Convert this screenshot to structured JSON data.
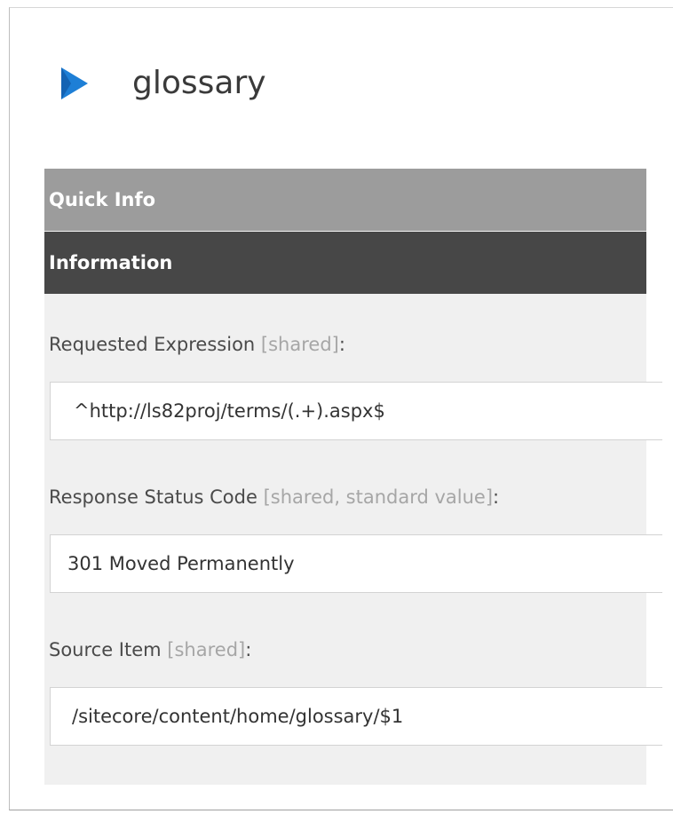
{
  "item": {
    "title": "glossary",
    "icon": "blue-play-triangle-icon",
    "accent_color": "#1e7fd6"
  },
  "sections": {
    "quick_info": "Quick Info",
    "information": "Information"
  },
  "fields": [
    {
      "label": "Requested Expression",
      "meta": "[shared]",
      "suffix": ":",
      "value": "^http://ls82proj/terms/(.+).aspx$"
    },
    {
      "label": "Response Status Code",
      "meta": "[shared, standard value]",
      "suffix": ":",
      "value": "301 Moved Permanently"
    },
    {
      "label": "Source Item",
      "meta": "[shared]",
      "suffix": ":",
      "value": "/sitecore/content/home/glossary/$1"
    }
  ]
}
